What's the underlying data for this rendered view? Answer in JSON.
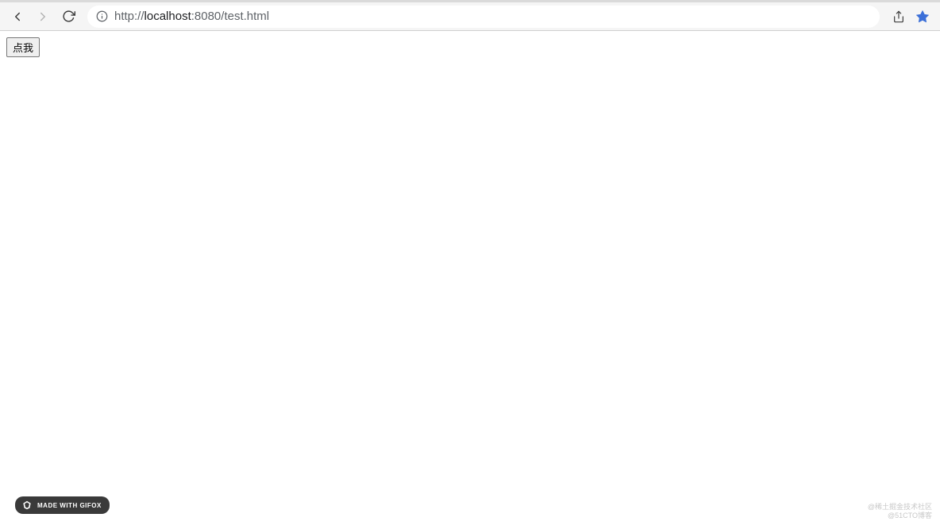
{
  "toolbar": {
    "url_pre": "http://",
    "url_host": "localhost",
    "url_post": ":8080/test.html"
  },
  "page": {
    "button_label": "点我"
  },
  "badge": {
    "label": "MADE WITH GIFOX"
  },
  "watermark": {
    "line1": "@稀土掘金技术社区",
    "line2": "@51CTO博客"
  },
  "icons": {
    "back": "back-icon",
    "forward": "forward-icon",
    "reload": "reload-icon",
    "info": "info-icon",
    "share": "share-icon",
    "bookmark": "bookmark-star-icon",
    "gifox": "gifox-fox-icon"
  }
}
